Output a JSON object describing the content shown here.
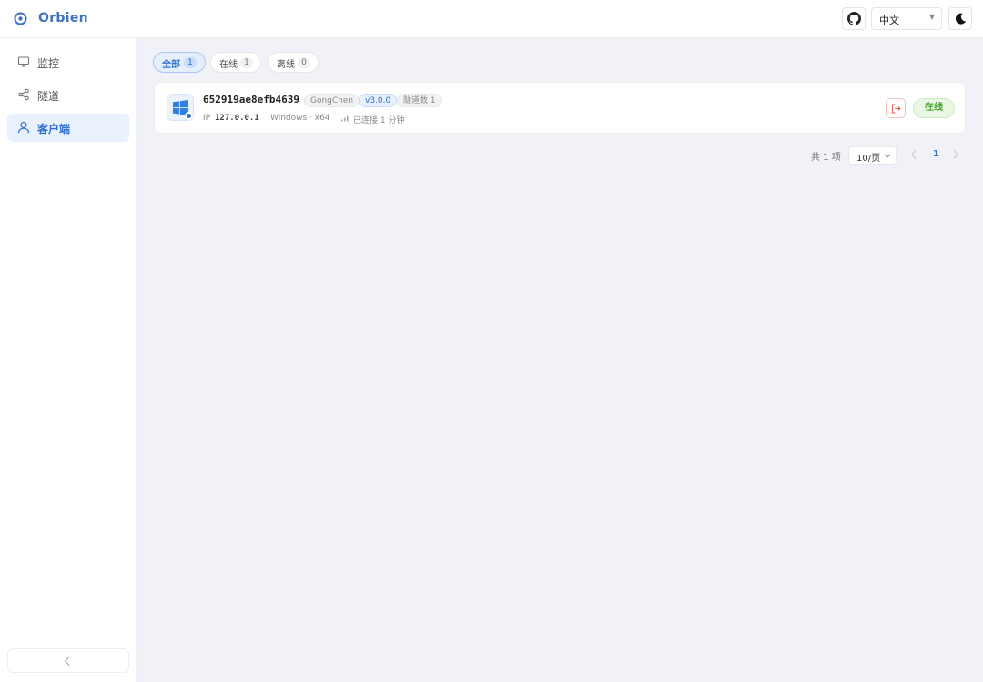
{
  "header": {
    "brand": "Orbien",
    "language": "中文"
  },
  "sidebar": {
    "items": [
      {
        "label": "监控",
        "icon": "monitor-icon"
      },
      {
        "label": "隧道",
        "icon": "share-icon"
      },
      {
        "label": "客户端",
        "icon": "user-icon",
        "active": true
      }
    ]
  },
  "filters": {
    "tabs": [
      {
        "label": "全部",
        "count": "1",
        "active": true
      },
      {
        "label": "在线",
        "count": "1"
      },
      {
        "label": "离线",
        "count": "0"
      }
    ]
  },
  "clients": [
    {
      "id": "652919ae8efb4639",
      "user": "GongChen",
      "version": "v3.0.0",
      "tunnels": "隧道数 1",
      "ip_label": "IP",
      "ip": "127.0.0.1",
      "os": "Windows · x64",
      "uptime": "已连接 1 分钟",
      "status": "在线",
      "os_icon": "windows-icon"
    }
  ],
  "pagination": {
    "total": "共 1 项",
    "page_size": "10/页",
    "current": "1"
  },
  "colors": {
    "accent": "#2f6fd0",
    "online": "#4aa531",
    "danger": "#e05a5a"
  }
}
